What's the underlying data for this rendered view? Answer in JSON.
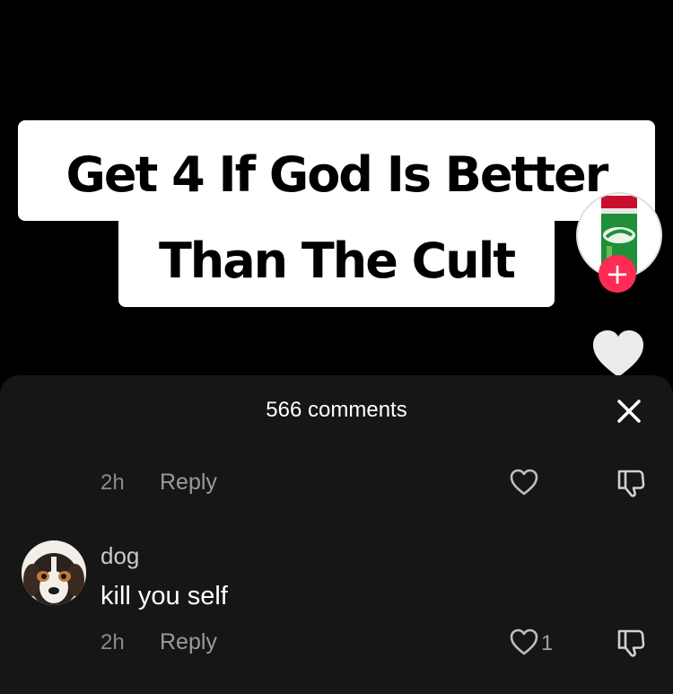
{
  "video": {
    "caption_line1": "Get 4 If God Is Better",
    "caption_line2": "Than The Cult",
    "creator_avatar": "sprite-can-avatar",
    "follow_symbol": "+",
    "like_icon": "heart-icon",
    "accent_color": "#fe2c55"
  },
  "comments_panel": {
    "count_label": "566 comments",
    "close_icon": "close-icon",
    "comments": [
      {
        "time": "2h",
        "reply_label": "Reply",
        "like_count": ""
      },
      {
        "username": "dog",
        "text": "kill you self",
        "time": "2h",
        "reply_label": "Reply",
        "like_count": "1"
      }
    ]
  }
}
